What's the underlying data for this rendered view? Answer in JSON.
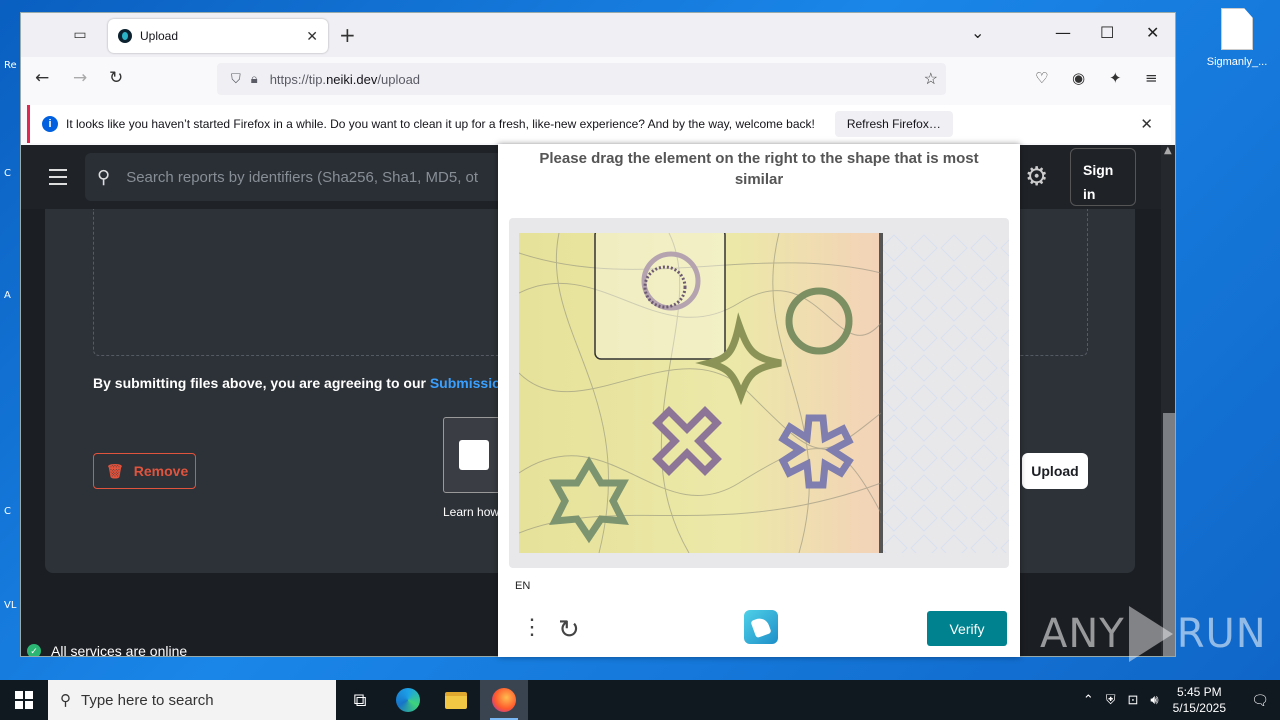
{
  "browser": {
    "tab_title": "Upload",
    "url_prefix": "https://tip.",
    "url_host": "neiki.dev",
    "url_path": "/upload",
    "notification": "It looks like you haven’t started Firefox in a while. Do you want to clean it up for a fresh, like-new experience? And by the way, welcome back!",
    "refresh_label": "Refresh Firefox…"
  },
  "page": {
    "search_placeholder": "Search reports by identifiers (Sha256, Sha1, MD5, ot",
    "signin_label": "Sign in",
    "agree_text": "By submitting files above, you are agreeing to our ",
    "agree_link": "Submission",
    "remove_label": "Remove",
    "learn_text": "Learn how",
    "upload_label": "Upload",
    "status_text": "All services are online"
  },
  "captcha": {
    "prompt": "Please drag the element on the right to the shape that is most similar",
    "language": "EN",
    "verify_label": "Verify",
    "shapes": [
      "spiral-ring",
      "ring",
      "four-point-star",
      "x-cross",
      "asterisk",
      "six-point-star"
    ]
  },
  "desktop": {
    "file_label": "Sigmanly_...",
    "left_fragments": [
      "Re",
      "C",
      "A",
      "C",
      "VL"
    ]
  },
  "taskbar": {
    "search_placeholder": "Type here to search",
    "time": "5:45 PM",
    "date": "5/15/2025"
  },
  "watermark": {
    "left": "ANY",
    "right": "RUN"
  },
  "colors": {
    "accent_verify": "#00838f",
    "remove_red": "#e0533d",
    "link_blue": "#3aa0ff",
    "status_green": "#2bb673"
  }
}
